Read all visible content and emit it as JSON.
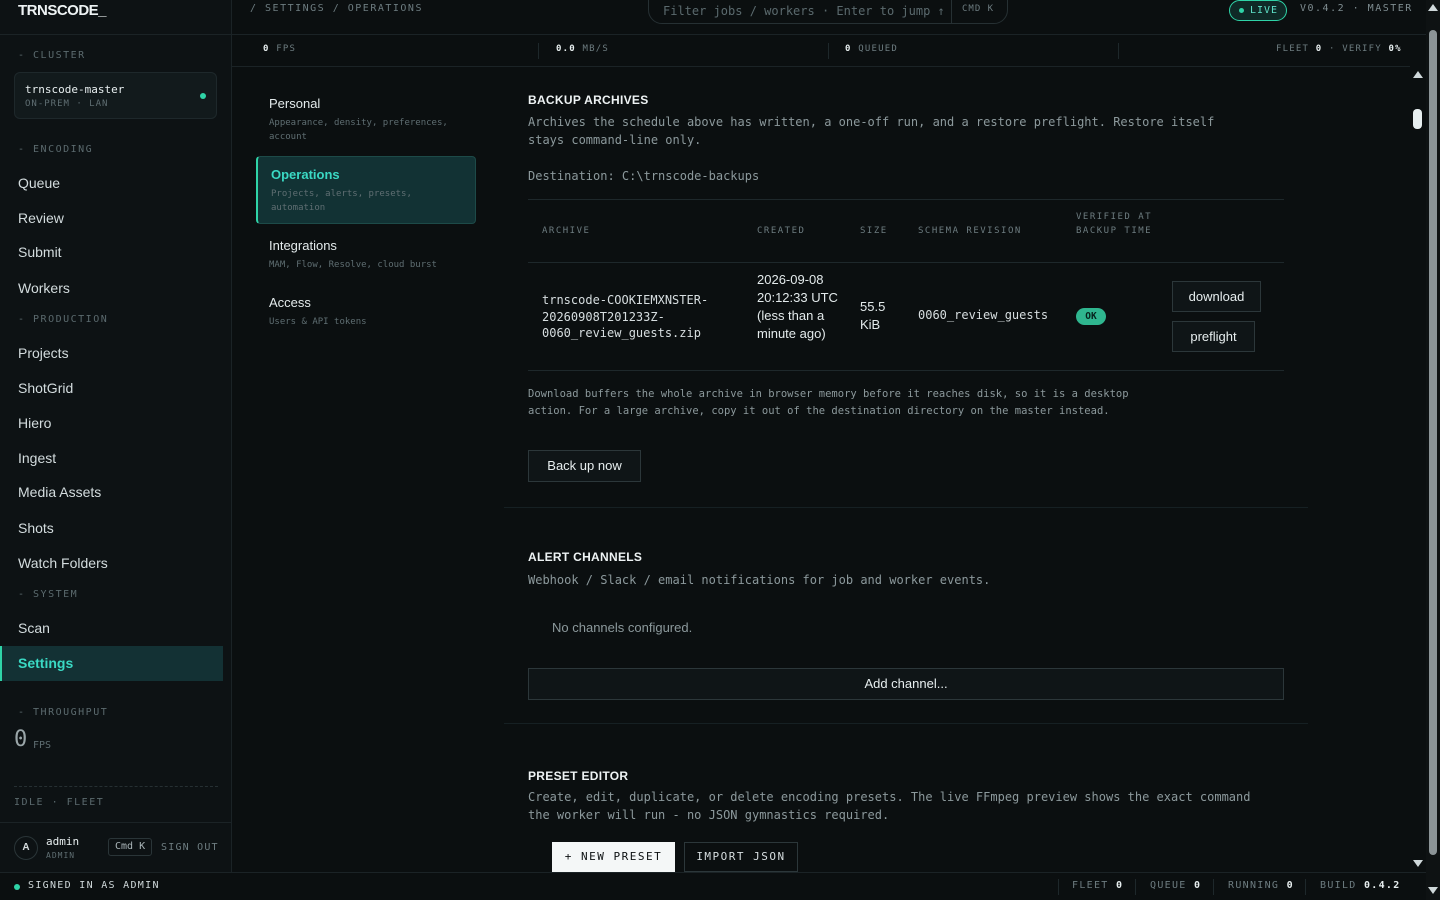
{
  "app": {
    "brand": "TRNSCODE_"
  },
  "sidebar": {
    "cluster_heading": "- CLUSTER",
    "cluster": {
      "name": "trnscode-master",
      "sub": "ON-PREM · LAN",
      "status_color": "#2fd3a7"
    },
    "encoding_heading": "- ENCODING",
    "encoding_items": [
      "Queue",
      "Review",
      "Submit",
      "Workers"
    ],
    "production_heading": "- PRODUCTION",
    "production_items": [
      "Projects",
      "ShotGrid",
      "Hiero",
      "Ingest",
      "Media Assets",
      "Shots",
      "Watch Folders"
    ],
    "system_heading": "- SYSTEM",
    "system_items": [
      "Scan",
      "Settings"
    ],
    "active_item": "Settings",
    "throughput_heading": "- THROUGHPUT",
    "throughput_value": "0",
    "throughput_unit": "FPS",
    "idle_fleet": "IDLE · FLEET",
    "user": {
      "avatar": "A",
      "name": "admin",
      "role": "ADMIN",
      "shortcut": "Cmd K",
      "sign_out": "SIGN OUT"
    }
  },
  "topbar": {
    "breadcrumb": "/ SETTINGS / OPERATIONS",
    "search_placeholder": "Filter jobs / workers · Enter to jump ↑",
    "search_shortcut": "CMD K",
    "live_label": "LIVE",
    "version": "V0.4.2 · MASTER"
  },
  "stats": {
    "fps_value": "0",
    "fps_label": "FPS",
    "mbs_value": "0.0",
    "mbs_label": "MB/S",
    "queued_value": "0",
    "queued_label": "QUEUED",
    "fleet_label": "FLEET",
    "fleet_value": "0",
    "verify_label": "VERIFY",
    "verify_value": "0%"
  },
  "subnav": [
    {
      "title": "Personal",
      "desc": "Appearance, density, preferences, account"
    },
    {
      "title": "Operations",
      "desc": "Projects, alerts, presets, automation"
    },
    {
      "title": "Integrations",
      "desc": "MAM, Flow, Resolve, cloud burst"
    },
    {
      "title": "Access",
      "desc": "Users & API tokens"
    }
  ],
  "backup": {
    "title": "BACKUP ARCHIVES",
    "description": "Archives the schedule above has written, a one-off run, and a restore preflight. Restore itself stays command-line only.",
    "destination": "Destination: C:\\trnscode-backups",
    "columns": [
      "ARCHIVE",
      "CREATED",
      "SIZE",
      "SCHEMA REVISION",
      "VERIFIED AT BACKUP TIME"
    ],
    "rows": [
      {
        "archive": "trnscode-COOKIEMXNSTER-20260908T201233Z-0060_review_guests.zip",
        "created": "2026-09-08 20:12:33 UTC (less than a minute ago)",
        "size": "55.5 KiB",
        "schema": "0060_review_guests",
        "verified": "OK",
        "download_label": "download",
        "preflight_label": "preflight"
      }
    ],
    "note": "Download buffers the whole archive in browser memory before it reaches disk, so it is a desktop action. For a large archive, copy it out of the destination directory on the master instead.",
    "backup_now_label": "Back up now"
  },
  "alerts": {
    "title": "ALERT CHANNELS",
    "description": "Webhook / Slack / email notifications for job and worker events.",
    "empty": "No channels configured.",
    "add_label": "Add channel..."
  },
  "presets": {
    "title": "PRESET EDITOR",
    "description": "Create, edit, duplicate, or delete encoding presets. The live FFmpeg preview shows the exact command the worker will run - no JSON gymnastics required.",
    "new_label": "+ NEW PRESET",
    "import_label": "IMPORT JSON"
  },
  "footer": {
    "status": "SIGNED IN AS ADMIN",
    "fleet_label": "FLEET",
    "fleet_value": "0",
    "queue_label": "QUEUE",
    "queue_value": "0",
    "running_label": "RUNNING",
    "running_value": "0",
    "build_label": "BUILD",
    "build_value": "0.4.2"
  },
  "colors": {
    "accent": "#2fd3a7",
    "background": "#0b0f10",
    "active_bg": "#133134"
  }
}
